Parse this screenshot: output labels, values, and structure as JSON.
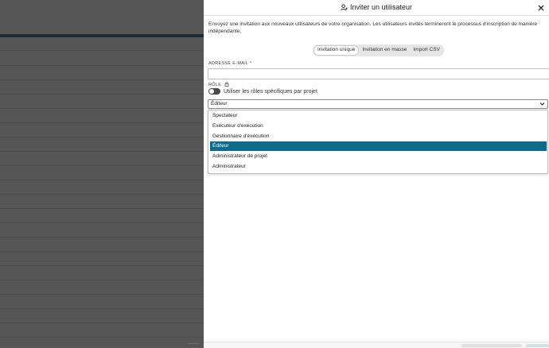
{
  "dialog": {
    "title": "Inviter un utilisateur",
    "description": "Envoyez une invitation aux nouveaux utilisateurs de votre organisation. Les utilisateurs invités termineront le processus d'inscription de manière indépendante.",
    "tabs": [
      "Invitation unique",
      "Invitation en masse",
      "Import CSV"
    ],
    "active_tab": "Invitation unique",
    "email": {
      "label": "ADRESSE E-MAIL",
      "required_marker": "*",
      "value": "",
      "placeholder": ""
    },
    "role": {
      "label": "RÔLE",
      "toggle_label": "Utiliser les rôles spécifiques par projet",
      "toggle_on": false,
      "selected": "Éditeur",
      "options": [
        "Spectateur",
        "Exécuteur d'exécution",
        "Gestionnaire d'exécution",
        "Éditeur",
        "Administrateur de projet",
        "Administrateur"
      ]
    }
  },
  "colors": {
    "accent": "#0e6b8c",
    "overlay": "#555555"
  },
  "icons": {
    "title": "user-plus-icon",
    "close": "close-icon",
    "role_lock": "lock-icon",
    "select": "chevron-down-icon"
  }
}
